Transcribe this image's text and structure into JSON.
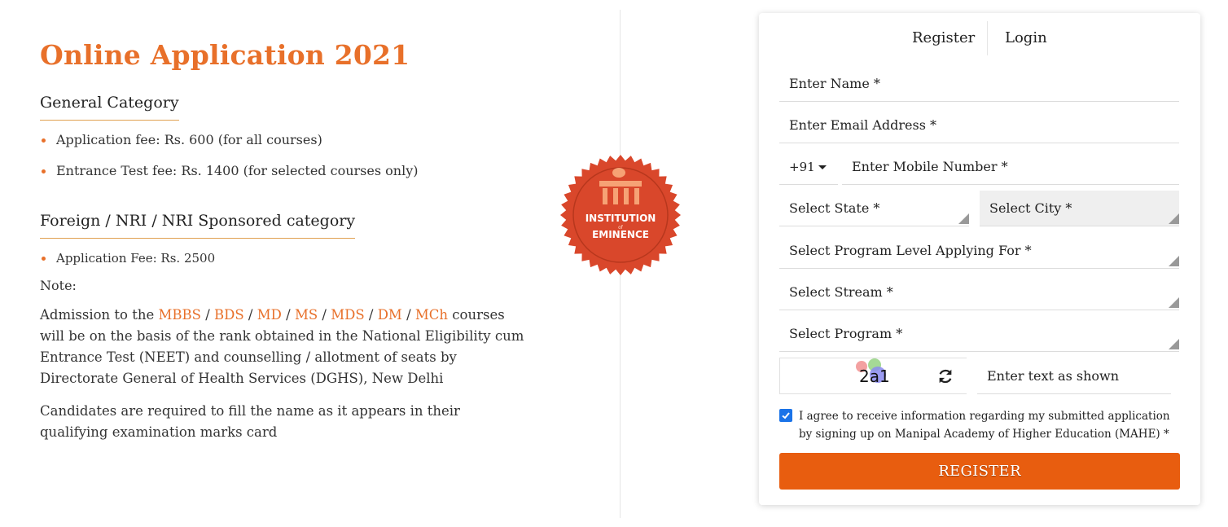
{
  "left": {
    "title": "Online Application 2021",
    "general": {
      "heading": "General Category",
      "items": [
        {
          "label": "Application fee: ",
          "amount": "Rs. 600",
          "suffix": " (for all courses)"
        },
        {
          "label": "Entrance Test fee: ",
          "amount": "Rs. 1400",
          "suffix": " (for selected courses only)"
        }
      ]
    },
    "foreign": {
      "heading": "Foreign / NRI / NRI Sponsored category",
      "items": [
        {
          "label": "Application Fee: Rs. 2500"
        }
      ]
    },
    "note_label": "Note:",
    "note": {
      "prefix": "Admission to the ",
      "courses": [
        "MBBS",
        "BDS",
        "MD",
        "MS",
        "MDS",
        "DM",
        "MCh"
      ],
      "separator": " / ",
      "suffix": " courses will be on the basis of the rank obtained in the National Eligibility cum Entrance Test (NEET) and counselling / allotment of seats by Directorate General of Health Services (DGHS), New Delhi"
    },
    "note2": "Candidates are required to fill the name as it appears in their qualifying examination marks card"
  },
  "badge": {
    "line1": "INSTITUTION",
    "line2": "of",
    "line3": "EMINENCE",
    "color": "#d9472b"
  },
  "form": {
    "tabs": [
      {
        "label": "Register"
      },
      {
        "label": "Login"
      }
    ],
    "name_placeholder": "Enter Name *",
    "email_placeholder": "Enter Email Address *",
    "country_code": "+91",
    "mobile_placeholder": "Enter Mobile Number *",
    "state_placeholder": "Select State *",
    "city_placeholder": "Select City *",
    "level_placeholder": "Select Program Level Applying For *",
    "stream_placeholder": "Select Stream *",
    "program_placeholder": "Select Program *",
    "captcha_text": "2a1",
    "captcha_placeholder": "Enter text as shown",
    "agree_text": "I agree to receive information regarding my submitted application by signing up on Manipal Academy of Higher Education (MAHE) *",
    "agree_checked": true,
    "submit_label": "REGISTER",
    "accent_color": "#e85d0f"
  }
}
